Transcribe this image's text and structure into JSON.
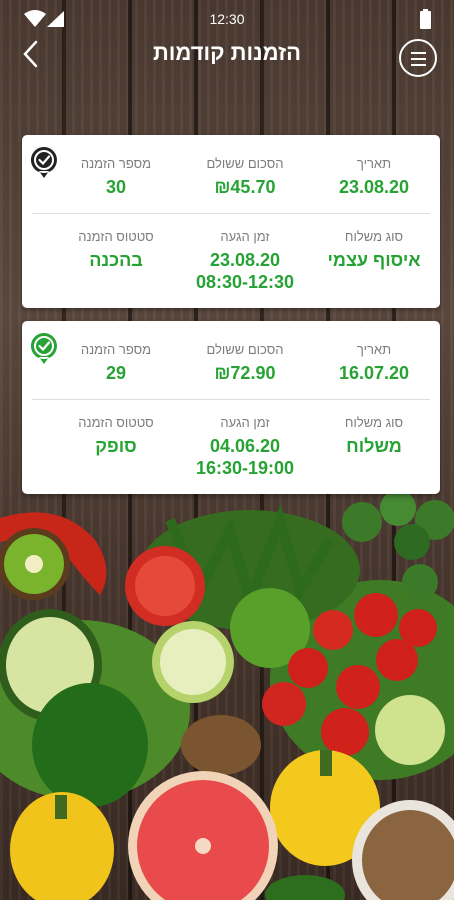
{
  "status_bar": {
    "time": "12:30"
  },
  "header": {
    "title": "הזמנות קודמות"
  },
  "field_labels": {
    "date": "תאריך",
    "amount_paid": "הסכום ששולם",
    "order_number": "מספר הזמנה",
    "delivery_type": "סוג משלוח",
    "arrival_time": "זמן הגעה",
    "order_status": "סטטוס הזמנה"
  },
  "orders": [
    {
      "date": "23.08.20",
      "amount_paid": "₪45.70",
      "order_number": "30",
      "delivery_type": "איסוף עצמי",
      "arrival_date": "23.08.20",
      "arrival_window": "08:30-12:30",
      "status": "בהכנה",
      "status_icon": "check-badge-dark-icon",
      "status_icon_color": "#222222"
    },
    {
      "date": "16.07.20",
      "amount_paid": "₪72.90",
      "order_number": "29",
      "delivery_type": "משלוח",
      "arrival_date": "04.06.20",
      "arrival_window": "16:30-19:00",
      "status": "סופק",
      "status_icon": "check-badge-green-icon",
      "status_icon_color": "#27a335"
    }
  ],
  "colors": {
    "accent_green": "#27a335",
    "label_gray": "#7d7d7d"
  }
}
